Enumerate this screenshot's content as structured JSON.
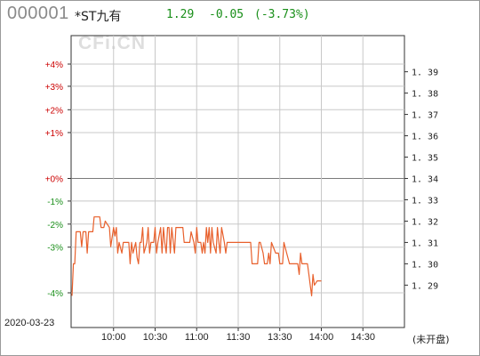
{
  "header": {
    "code": "000001",
    "name": "*ST九有",
    "price": "1.29",
    "change": "-0.05",
    "change_pct": "(-3.73%)"
  },
  "watermark": "CFi.CN",
  "date": "2020-03-23",
  "status": "(未开盘)",
  "colors": {
    "up": "#cc0000",
    "down": "#1a8f1a",
    "line": "#e8602c",
    "grid": "#c8c8c8",
    "axis": "#333333"
  },
  "chart_data": {
    "type": "line",
    "title": "",
    "xlabel": "",
    "ylabel": "",
    "grid": true,
    "prev_close": 1.34,
    "ylim": [
      1.2864,
      1.3936
    ],
    "left_ticks": [
      {
        "value": 1.3936,
        "label": "+4%"
      },
      {
        "value": 1.3832,
        "label": "+3%"
      },
      {
        "value": 1.3722,
        "label": "+2%"
      },
      {
        "value": 1.3615,
        "label": "+1%"
      },
      {
        "value": 1.34,
        "label": "+0%"
      },
      {
        "value": 1.3294,
        "label": "-1%"
      },
      {
        "value": 1.3186,
        "label": "-2%"
      },
      {
        "value": 1.3078,
        "label": "-3%"
      },
      {
        "value": 1.2864,
        "label": "-4%"
      }
    ],
    "right_ticks": [
      "1.39",
      "1.38",
      "1.37",
      "1.36",
      "1.35",
      "1.34",
      "1.33",
      "1.32",
      "1.31",
      "1.30",
      "1.29"
    ],
    "x_ticks": [
      "10:00",
      "10:30",
      "11:00",
      "11:30",
      "13:30",
      "14:00",
      "14:30"
    ],
    "x_tick_minutes": [
      30,
      60,
      90,
      120,
      150,
      180,
      210
    ],
    "session_minutes": 240,
    "series": [
      {
        "points": [
          [
            0,
            1.285
          ],
          [
            1,
            1.3
          ],
          [
            2,
            1.3
          ],
          [
            3,
            1.315
          ],
          [
            4,
            1.315
          ],
          [
            6,
            1.315
          ],
          [
            7,
            1.308
          ],
          [
            8,
            1.315
          ],
          [
            10,
            1.315
          ],
          [
            11,
            1.305
          ],
          [
            12,
            1.315
          ],
          [
            15,
            1.315
          ],
          [
            16,
            1.322
          ],
          [
            20,
            1.322
          ],
          [
            21,
            1.317
          ],
          [
            23,
            1.317
          ],
          [
            24,
            1.32
          ],
          [
            27,
            1.317
          ],
          [
            28,
            1.308
          ],
          [
            30,
            1.317
          ],
          [
            31,
            1.313
          ],
          [
            32,
            1.317
          ],
          [
            33,
            1.305
          ],
          [
            34,
            1.31
          ],
          [
            36,
            1.305
          ],
          [
            37,
            1.31
          ],
          [
            41,
            1.31
          ],
          [
            42,
            1.3
          ],
          [
            43,
            1.31
          ],
          [
            44,
            1.305
          ],
          [
            46,
            1.31
          ],
          [
            47,
            1.303
          ],
          [
            48,
            1.3
          ],
          [
            49,
            1.31
          ],
          [
            50,
            1.31
          ],
          [
            51,
            1.317
          ],
          [
            52,
            1.305
          ],
          [
            54,
            1.31
          ],
          [
            55,
            1.317
          ],
          [
            56,
            1.305
          ],
          [
            57,
            1.31
          ],
          [
            59,
            1.31
          ],
          [
            60,
            1.317
          ],
          [
            61,
            1.305
          ],
          [
            62,
            1.31
          ],
          [
            64,
            1.317
          ],
          [
            65,
            1.305
          ],
          [
            66,
            1.317
          ],
          [
            67,
            1.31
          ],
          [
            68,
            1.305
          ],
          [
            69,
            1.317
          ],
          [
            70,
            1.317
          ],
          [
            71,
            1.305
          ],
          [
            72,
            1.317
          ],
          [
            74,
            1.305
          ],
          [
            75,
            1.317
          ],
          [
            80,
            1.317
          ],
          [
            81,
            1.31
          ],
          [
            82,
            1.31
          ],
          [
            85,
            1.31
          ],
          [
            86,
            1.315
          ],
          [
            88,
            1.31
          ],
          [
            89,
            1.305
          ],
          [
            90,
            1.317
          ],
          [
            91,
            1.31
          ],
          [
            93,
            1.31
          ],
          [
            94,
            1.305
          ],
          [
            95,
            1.31
          ],
          [
            96,
            1.305
          ],
          [
            97,
            1.317
          ],
          [
            98,
            1.31
          ],
          [
            99,
            1.317
          ],
          [
            100,
            1.305
          ],
          [
            101,
            1.317
          ],
          [
            102,
            1.31
          ],
          [
            104,
            1.305
          ],
          [
            105,
            1.317
          ],
          [
            106,
            1.31
          ],
          [
            107,
            1.305
          ],
          [
            108,
            1.317
          ],
          [
            110,
            1.31
          ],
          [
            111,
            1.305
          ],
          [
            112,
            1.31
          ],
          [
            129,
            1.31
          ],
          [
            130,
            1.3
          ],
          [
            134,
            1.3
          ],
          [
            135,
            1.31
          ],
          [
            136,
            1.31
          ],
          [
            138,
            1.305
          ],
          [
            139,
            1.3
          ],
          [
            141,
            1.3
          ],
          [
            142,
            1.305
          ],
          [
            143,
            1.3
          ],
          [
            144,
            1.31
          ],
          [
            147,
            1.305
          ],
          [
            149,
            1.305
          ],
          [
            150,
            1.3
          ],
          [
            152,
            1.3
          ],
          [
            153,
            1.31
          ],
          [
            155,
            1.305
          ],
          [
            157,
            1.3
          ],
          [
            163,
            1.3
          ],
          [
            164,
            1.295
          ],
          [
            165,
            1.305
          ],
          [
            166,
            1.3
          ],
          [
            170,
            1.3
          ],
          [
            171,
            1.295
          ],
          [
            172,
            1.29
          ],
          [
            173,
            1.285
          ],
          [
            174,
            1.295
          ],
          [
            175,
            1.29
          ],
          [
            177,
            1.292
          ],
          [
            180,
            1.292
          ]
        ]
      }
    ]
  }
}
